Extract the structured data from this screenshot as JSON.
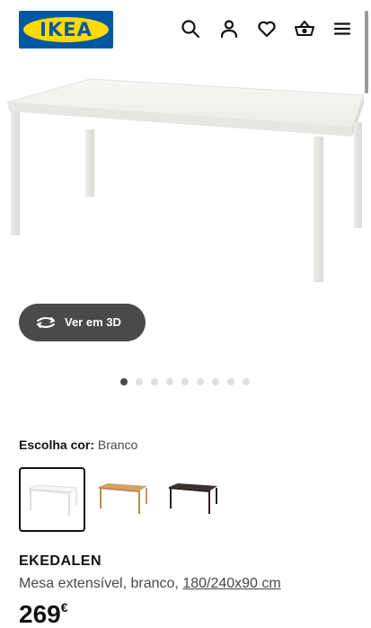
{
  "header": {
    "logo_text": "IKEA",
    "brand_colors": {
      "blue": "#0058a3",
      "yellow": "#ffdb00"
    },
    "icons": [
      "search-icon",
      "user-icon",
      "heart-icon",
      "basket-icon",
      "menu-icon"
    ]
  },
  "product_image": {
    "alt": ""
  },
  "view3d": {
    "label": "Ver em 3D",
    "icon": "rotate-3d-icon"
  },
  "carousel": {
    "total": 9,
    "active_index": 0
  },
  "color_choice": {
    "label": "Escolha cor:",
    "value": "Branco",
    "swatches": [
      {
        "name": "white",
        "color": "#f4f4f2",
        "selected": true
      },
      {
        "name": "oak",
        "color": "#c9975b",
        "selected": false
      },
      {
        "name": "black-brown",
        "color": "#2b2322",
        "selected": false
      }
    ]
  },
  "product": {
    "name": "EKEDALEN",
    "description": "Mesa extensível, branco, ",
    "size_link": "180/240x90 cm",
    "price": "269",
    "currency": "€"
  }
}
